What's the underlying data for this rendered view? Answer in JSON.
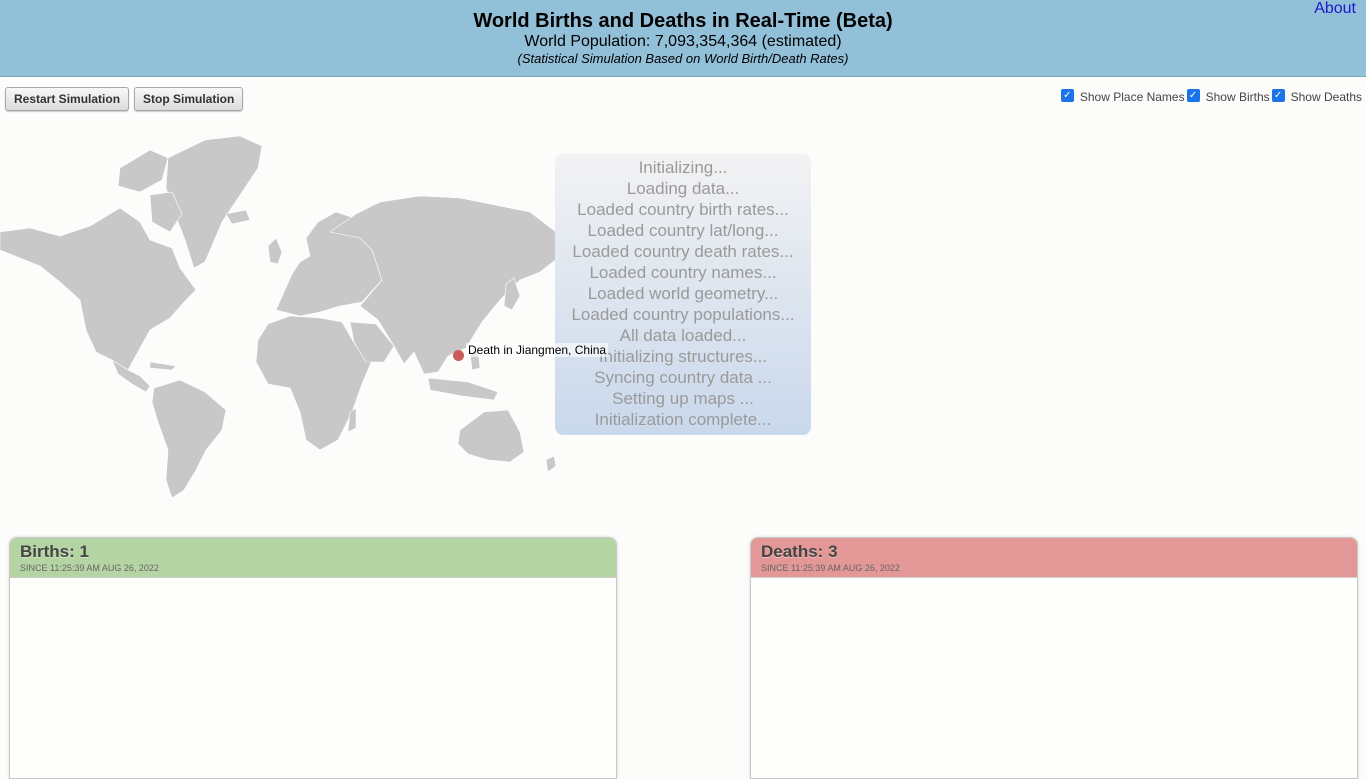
{
  "header": {
    "title": "World Births and Deaths in Real-Time (Beta)",
    "population": "World Population: 7,093,354,364 (estimated)",
    "subtitle": "(Statistical Simulation Based on World Birth/Death Rates)",
    "about": "About"
  },
  "controls": {
    "restart": "Restart Simulation",
    "stop": "Stop Simulation",
    "show_place_names": "Show Place Names",
    "show_births": "Show Births",
    "show_deaths": "Show Deaths"
  },
  "loading": [
    "Initializing...",
    "Loading data...",
    "Loaded country birth rates...",
    "Loaded country lat/long...",
    "Loaded country death rates...",
    "Loaded country names...",
    "Loaded world geometry...",
    "Loaded country populations...",
    "All data loaded...",
    "Initializing structures...",
    "Syncing country data ...",
    "Setting up maps ...",
    "Initialization complete..."
  ],
  "map": {
    "death_label": "Death in Jiangmen, China"
  },
  "births": {
    "title": "Births: 1",
    "since": "SINCE 11:25:39 AM AUG 26, 2022"
  },
  "deaths": {
    "title": "Deaths: 3",
    "since": "SINCE 11:25:39 AM AUG 26, 2022"
  },
  "colors": {
    "header": "#93c0d9",
    "births": "#b4d5a3",
    "deaths": "#e39797",
    "land": "#c8c8c8"
  }
}
